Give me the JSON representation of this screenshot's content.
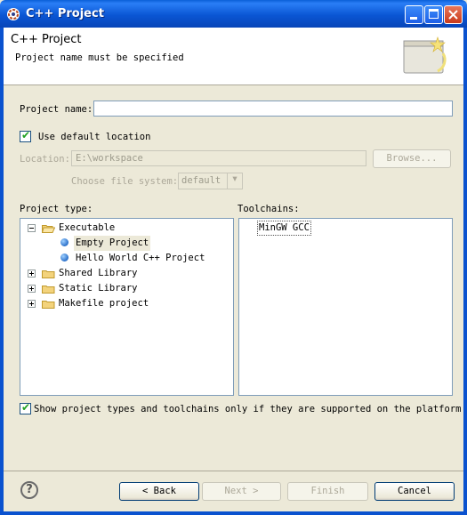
{
  "window": {
    "title": "C++ Project"
  },
  "banner": {
    "title": "C++ Project",
    "message": "Project name must be specified"
  },
  "form": {
    "project_name_label": "Project name:",
    "project_name_value": "",
    "use_default_location_label": "Use default location",
    "use_default_location_checked": true,
    "location_label": "Location:",
    "location_value": "E:\\workspace",
    "browse_label": "Browse...",
    "filesystem_label": "Choose file system:",
    "filesystem_value": "default"
  },
  "project_types": {
    "label": "Project type:",
    "items": [
      {
        "label": "Executable",
        "expanded": true,
        "children": [
          {
            "label": "Empty Project",
            "selected": true
          },
          {
            "label": "Hello World C++ Project",
            "selected": false
          }
        ]
      },
      {
        "label": "Shared Library",
        "expanded": false
      },
      {
        "label": "Static Library",
        "expanded": false
      },
      {
        "label": "Makefile project",
        "expanded": false
      }
    ]
  },
  "toolchains": {
    "label": "Toolchains:",
    "items": [
      "MinGW GCC"
    ]
  },
  "filter": {
    "label": "Show project types and toolchains only if they are supported on the platform",
    "checked": true
  },
  "buttons": {
    "back": "< Back",
    "next": "Next >",
    "finish": "Finish",
    "cancel": "Cancel"
  },
  "colors": {
    "titlebar": "#0a56d4",
    "dialog_bg": "#ece9d8",
    "selection": "#ece9d8"
  }
}
